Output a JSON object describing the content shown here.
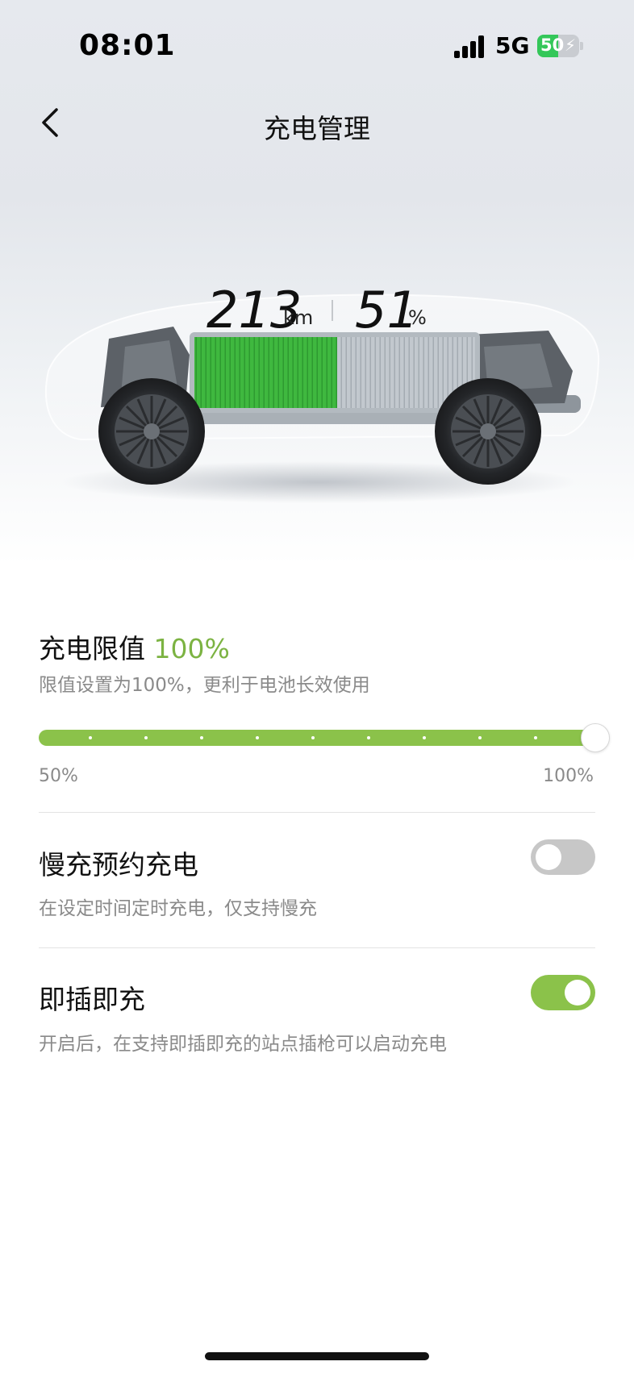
{
  "status_bar": {
    "time": "08:01",
    "network": "5G",
    "battery_level": "50",
    "battery_percent": 50
  },
  "header": {
    "title": "充电管理",
    "back_icon": "chevron-left-icon"
  },
  "vehicle": {
    "range_value": "213",
    "range_unit": "km",
    "battery_value": "51",
    "battery_unit": "%",
    "battery_fraction": 0.51
  },
  "charge_limit": {
    "title": "充电限值",
    "value": "100%",
    "description": "限值设置为100%，更利于电池长效使用",
    "slider_min_label": "50%",
    "slider_max_label": "100%",
    "slider_fraction": 1.0
  },
  "scheduled_charge": {
    "title": "慢充预约充电",
    "description": "在设定时间定时充电，仅支持慢充",
    "enabled": false
  },
  "plug_and_charge": {
    "title": "即插即充",
    "description": "开启后，在支持即插即充的站点插枪可以启动充电",
    "enabled": true
  },
  "colors": {
    "accent_green": "#7cb342",
    "track_green": "#8bc24a",
    "battery_cells_green": "#3fb83f",
    "status_battery_green": "#34c759"
  }
}
